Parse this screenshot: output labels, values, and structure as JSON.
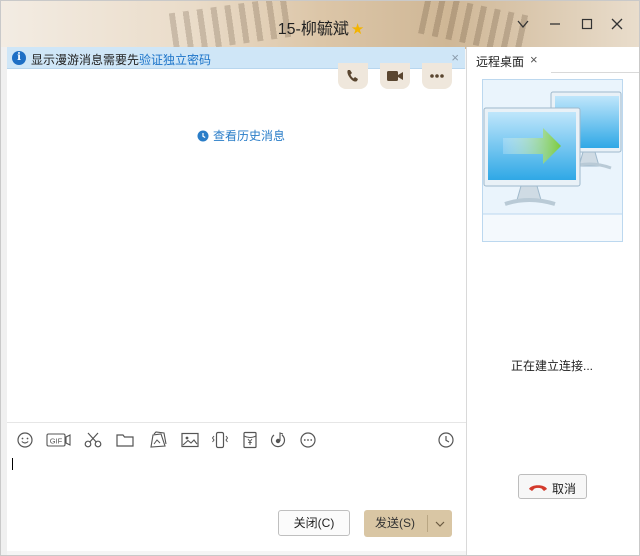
{
  "window": {
    "title": "15-柳毓斌",
    "title_star": "★",
    "accent_color": "#1a73c9",
    "send_color": "#d9c6a4"
  },
  "notice": {
    "text": "显示漫游消息需要先",
    "link": "验证独立密码",
    "close": "×"
  },
  "chat": {
    "history_link": "查看历史消息"
  },
  "toolbar": {
    "icons": [
      "smile-icon",
      "gif-icon",
      "scissors-icon",
      "folder-icon",
      "image-gallery-icon",
      "image-icon",
      "shake-icon",
      "red-envelope-icon",
      "music-icon",
      "more-icon",
      "history-clock-icon"
    ]
  },
  "buttons": {
    "close_label": "关闭(C)",
    "send_label": "发送(S)"
  },
  "remote_desktop": {
    "tab_label": "远程桌面",
    "tab_close": "×",
    "status": "正在建立连接...",
    "cancel_label": "取消"
  }
}
